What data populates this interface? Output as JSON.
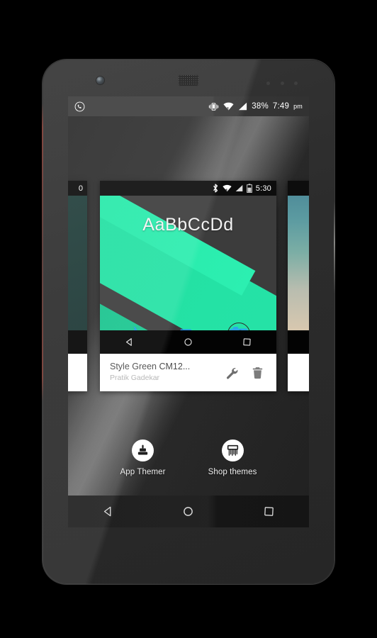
{
  "device": {
    "model": "nexus-5-mockup",
    "bezel_color": "#2b2b2b",
    "front_camera": "front-camera",
    "earpiece": "earpiece-speaker"
  },
  "status_bar": {
    "app_icon": "whatsapp-icon",
    "vibrate_icon": "vibrate-icon",
    "wifi_icon": "wifi-icon",
    "signal_icon": "cellular-signal-icon",
    "battery_percent": "38%",
    "time": "7:49",
    "meridiem": "pm"
  },
  "carousel": {
    "center_card": {
      "title": "Style Green CM12...",
      "author": "Pratik Gadekar",
      "customize_icon": "wrench-icon",
      "delete_icon": "trash-icon",
      "preview": {
        "status_time": "5:30",
        "bluetooth_icon": "bluetooth-icon",
        "wifi_icon": "wifi-icon",
        "signal_icon": "cellular-signal-icon",
        "battery_icon": "battery-icon",
        "font_sample": "AaBbCcDd",
        "dock": [
          {
            "name": "phone-icon"
          },
          {
            "name": "messaging-icon"
          },
          {
            "name": "camera-icon"
          }
        ],
        "nav": [
          {
            "name": "back-icon"
          },
          {
            "name": "home-icon"
          },
          {
            "name": "recents-icon"
          }
        ],
        "colors": {
          "accent_green": "#1fdfa0",
          "green_dark": "#12a87a",
          "wallpaper_bg": "#3a3a3a",
          "dock_blue": "#2196f3"
        }
      }
    },
    "left_card": {
      "status_time": "0",
      "accent": "#1d3a37"
    },
    "right_card": {
      "accent_top": "#4e8c99",
      "accent_bottom": "#d8c7ae"
    }
  },
  "actions": [
    {
      "label": "App Themer",
      "icon": "brush-stamp-icon"
    },
    {
      "label": "Shop themes",
      "icon": "paint-roller-icon"
    }
  ],
  "nav_bar": [
    {
      "name": "back-icon"
    },
    {
      "name": "home-icon"
    },
    {
      "name": "recents-icon"
    }
  ]
}
